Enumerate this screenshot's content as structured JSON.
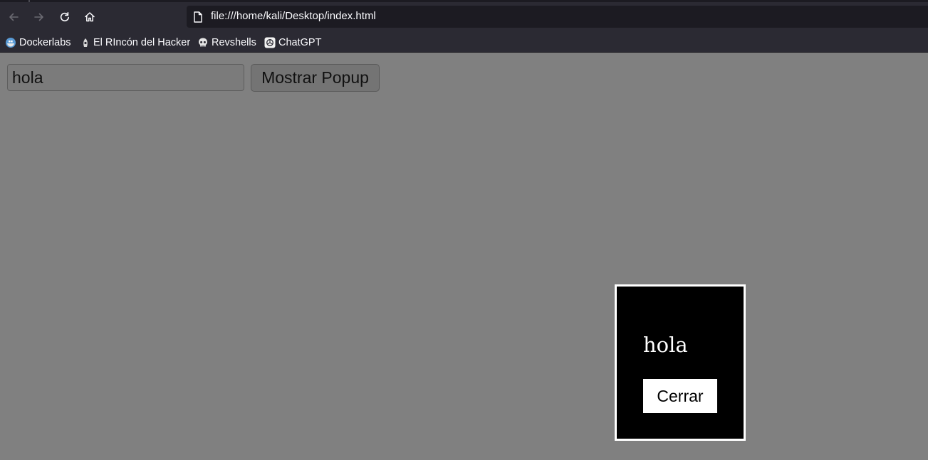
{
  "browser": {
    "url": "file:///home/kali/Desktop/index.html",
    "bookmarks": [
      {
        "label": "Dockerlabs",
        "icon": "dockerlabs-icon"
      },
      {
        "label": "El RIncón del Hacker",
        "icon": "rincon-hacker-icon"
      },
      {
        "label": "Revshells",
        "icon": "skull-icon"
      },
      {
        "label": "ChatGPT",
        "icon": "chatgpt-icon"
      }
    ]
  },
  "page": {
    "input_value": "hola",
    "show_button_label": "Mostrar Popup"
  },
  "popup": {
    "message": "hola",
    "close_label": "Cerrar"
  },
  "colors": {
    "page_background": "#808080",
    "chrome_background": "#2b2a33",
    "popup_background": "#000000",
    "popup_border": "#ffffff"
  }
}
